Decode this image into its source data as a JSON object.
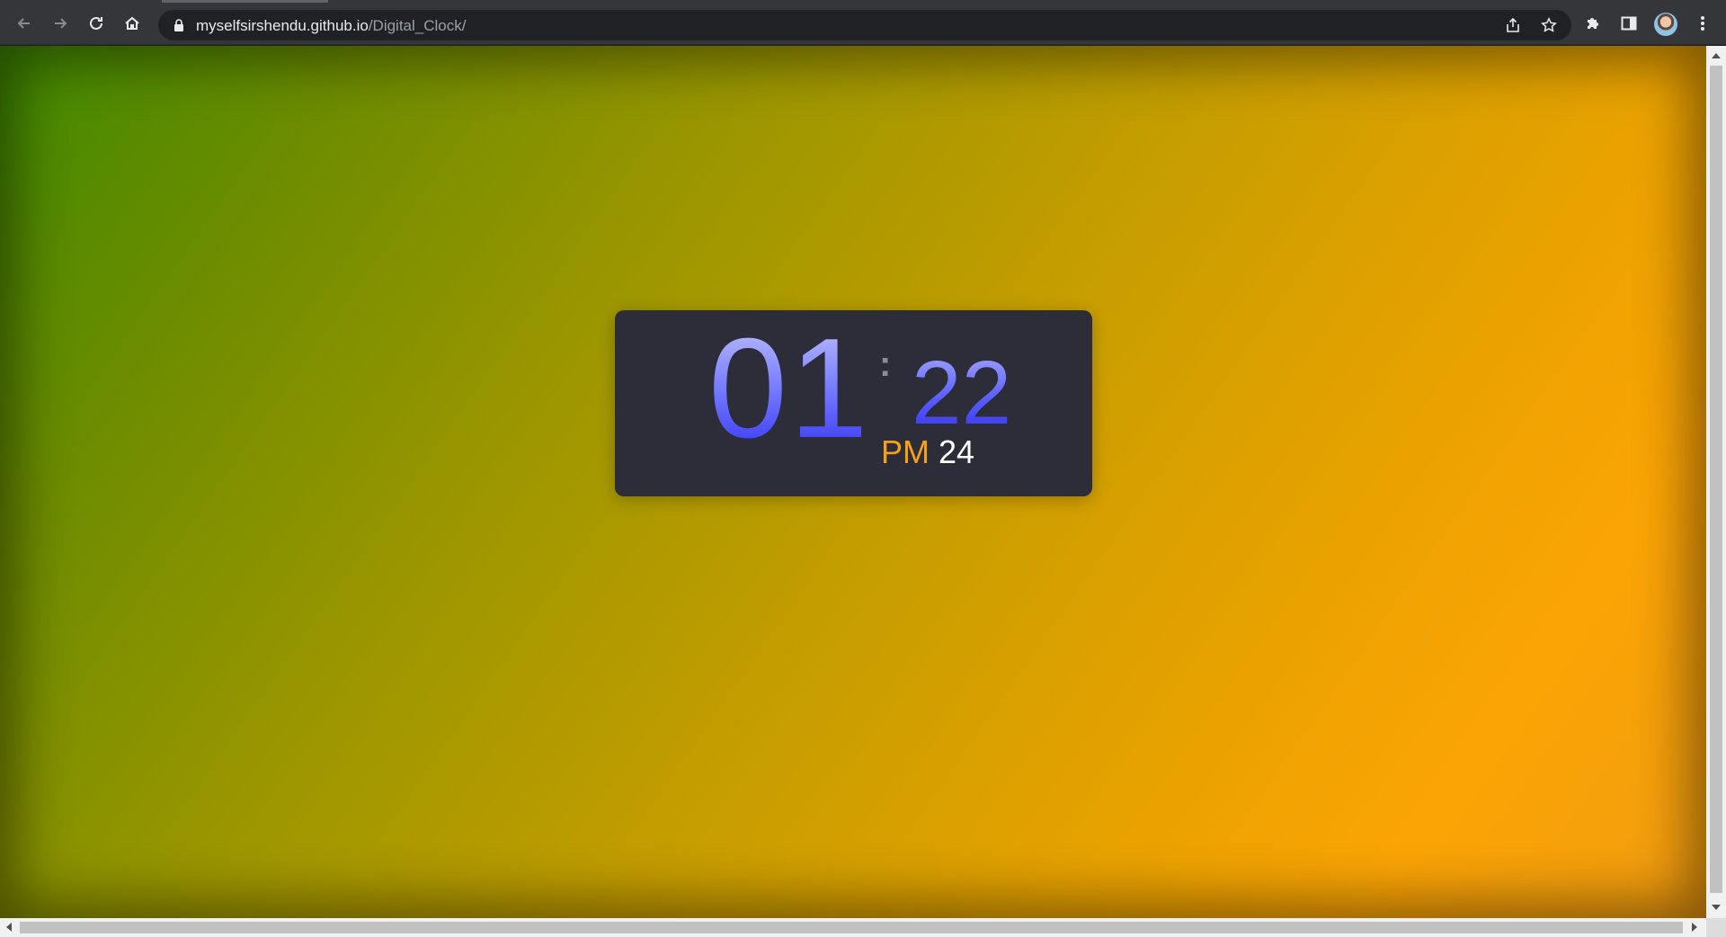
{
  "browser": {
    "url_host": "myselfsirshendu.github.io",
    "url_path": "/Digital_Clock/"
  },
  "clock": {
    "hours": "01",
    "separator": ":",
    "minutes": "22",
    "period": "PM",
    "seconds": "24"
  },
  "colors": {
    "card_background": "#2c2d38",
    "period_color": "#f5a017",
    "digit_color": "#5559ff",
    "page_gradient_start": "#3f8a00",
    "page_gradient_end": "#fba405"
  },
  "icons": {
    "back": "back-arrow-icon",
    "forward": "forward-arrow-icon",
    "reload": "reload-icon",
    "home": "home-icon",
    "lock": "lock-icon",
    "share": "share-icon",
    "bookmark": "star-icon",
    "extensions": "puzzle-icon",
    "side_panel": "side-panel-icon",
    "menu": "kebab-menu-icon"
  }
}
